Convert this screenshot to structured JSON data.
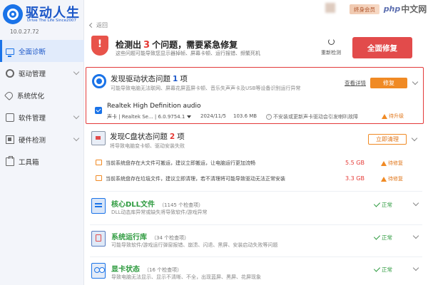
{
  "app": {
    "title": "驱动人生",
    "slogan": "Drive The Life Since2007",
    "version": "10.0.27.72"
  },
  "sidebar": {
    "items": [
      {
        "label": "全面诊断",
        "icon": "monitor-icon",
        "active": true
      },
      {
        "label": "驱动管理",
        "icon": "gear-icon",
        "expandable": true
      },
      {
        "label": "系统优化",
        "icon": "rocket-icon"
      },
      {
        "label": "软件管理",
        "icon": "box-icon",
        "expandable": true
      },
      {
        "label": "硬件检测",
        "icon": "chip-icon",
        "expandable": true
      },
      {
        "label": "工具箱",
        "icon": "toolbox-icon"
      }
    ]
  },
  "topbar": {
    "member_label": "终身会员",
    "watermark_php": "php",
    "watermark_text": "中文网"
  },
  "back_label": "返回",
  "alert": {
    "title_prefix": "检测出",
    "count": "3",
    "title_suffix": "个问题，需要紧急修复",
    "description": "这些问题可能导致您显示器掉帧、屏幕卡顿、运行报错、频繁死机",
    "refresh_label": "重新检测",
    "repair_all_label": "全面修复"
  },
  "driver_section": {
    "title_prefix": "发现驱动状态问题",
    "count": "1",
    "title_suffix": "项",
    "description": "可能导致电脑无法联网、屏幕花屏蓝屏卡顿、音乐失声声卡及USB等设备识别运行异常",
    "detail_link": "查看详情",
    "repair_label": "修复",
    "driver": {
      "name": "Realtek High Definition audio",
      "meta": "声卡 | Realtek Se... | 6.0.9754.1",
      "date": "2024/11/5",
      "size": "103.6 MB",
      "warning": "不安装或更新声卡驱动会引发喇叭故障",
      "status": "待升级"
    }
  },
  "disk_section": {
    "title_prefix": "发现C盘状态问题",
    "count": "2",
    "title_suffix": "项",
    "description": "将导致电脑变卡顿、驱动安装失败",
    "clean_label": "立即清理",
    "rows": [
      {
        "text": "当前系统盘存在大文件可搬运，建议立即搬运，让电脑运行更加流畅",
        "size": "5.5 GB",
        "status": "待修复"
      },
      {
        "text": "当前系统盘存在垃圾文件，建议立即清理，若不清理将可能导致驱动无法正常安装",
        "size": "3.3 GB",
        "status": "待修复"
      }
    ]
  },
  "ok_sections": [
    {
      "title": "核心DLL文件",
      "count": "（1145 个检查项）",
      "description": "DLL动态库异常或缺失将导致软件/游戏异常",
      "status": "正常",
      "icon": "dll-file-icon"
    },
    {
      "title": "系统运行库",
      "count": "（34 个检查项）",
      "description": "可能导致软件/游戏运行弹窗报错、崩溃、闪退、黑屏、安装启动失败等问题",
      "status": "正常",
      "icon": "runtime-library-icon"
    },
    {
      "title": "显卡状态",
      "count": "（16 个检查项）",
      "description": "导致电脑无法显示、显示不清晰、不全，出现蓝屏、黑屏、花屏现象",
      "status": "正常",
      "icon": "graphics-card-icon"
    }
  ]
}
